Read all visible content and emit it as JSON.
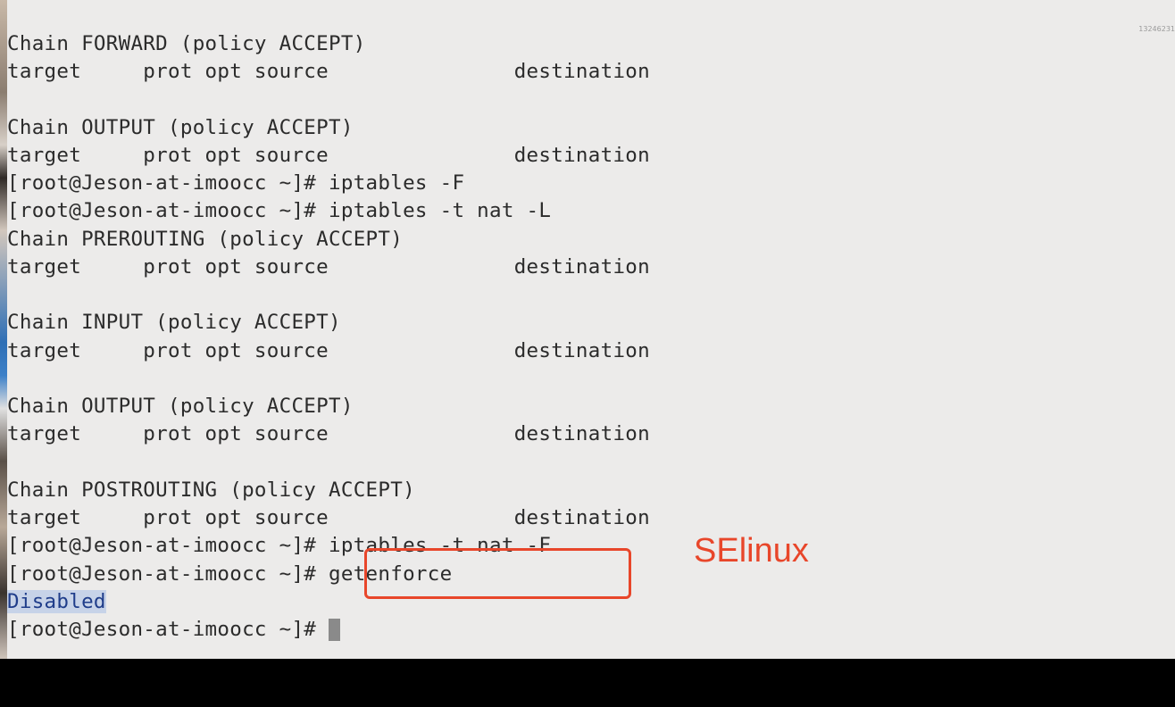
{
  "terminal": {
    "lines": [
      "Chain FORWARD (policy ACCEPT)",
      "target     prot opt source               destination",
      "",
      "Chain OUTPUT (policy ACCEPT)",
      "target     prot opt source               destination",
      "[root@Jeson-at-imoocc ~]# iptables -F",
      "[root@Jeson-at-imoocc ~]# iptables -t nat -L",
      "Chain PREROUTING (policy ACCEPT)",
      "target     prot opt source               destination",
      "",
      "Chain INPUT (policy ACCEPT)",
      "target     prot opt source               destination",
      "",
      "Chain OUTPUT (policy ACCEPT)",
      "target     prot opt source               destination",
      "",
      "Chain POSTROUTING (policy ACCEPT)",
      "target     prot opt source               destination",
      "[root@Jeson-at-imoocc ~]# iptables -t nat -F",
      "[root@Jeson-at-imoocc ~]# getenforce",
      "Disabled",
      "[root@Jeson-at-imoocc ~]# "
    ]
  },
  "watermark": "13246231",
  "annotation": {
    "label": "SElinux",
    "color": "#e8462a"
  },
  "colors": {
    "terminal_bg": "#ecebea",
    "text": "#2b2b2b",
    "selection": "#c7d3e8"
  }
}
